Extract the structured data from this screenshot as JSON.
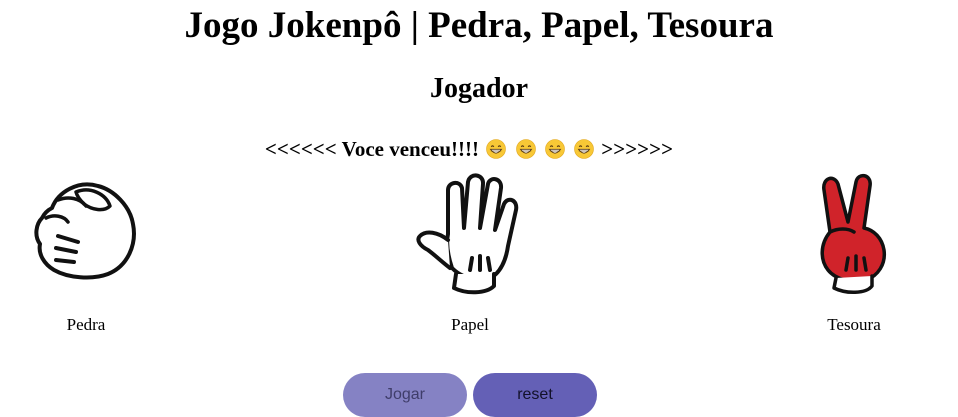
{
  "title": "Jogo Jokenpô | Pedra, Papel, Tesoura",
  "player_heading": "Jogador",
  "result": {
    "prefix": "<<<<<< Voce venceu!!!!",
    "suffix": ">>>>>>",
    "emoji_icon": "grinning-face-icon",
    "emoji_count": 4
  },
  "choices": [
    {
      "label": "Pedra",
      "icon": "fist-glove-icon"
    },
    {
      "label": "Papel",
      "icon": "open-hand-glove-icon"
    },
    {
      "label": "Tesoura",
      "icon": "peace-sign-glove-icon"
    }
  ],
  "buttons": {
    "play": "Jogar",
    "reset": "reset"
  },
  "colors": {
    "play_button": "#8582c4",
    "reset_button": "#6460b6",
    "scissors_glove": "#d0232a"
  }
}
